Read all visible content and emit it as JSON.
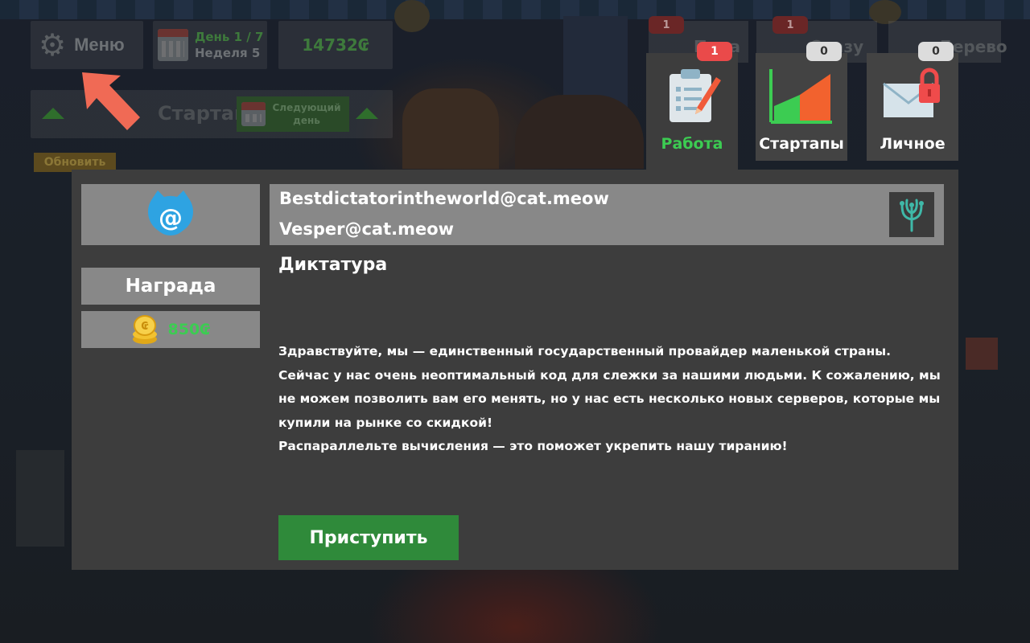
{
  "hud": {
    "menu_label": "Меню",
    "day_label": "День 1 / 7",
    "week_label": "Неделя 5",
    "money": "14732₢",
    "startups_title": "Стартапы",
    "next_day_label": "Следующий день",
    "update_label": "Обновить",
    "dim_tabs": [
      {
        "label": "Пара",
        "badge": "1"
      },
      {
        "label": "Сразу",
        "badge": "1"
      },
      {
        "label": "Дерево",
        "badge": ""
      }
    ]
  },
  "tabs": [
    {
      "label": "Работа",
      "badge": "1",
      "badge_color": "#ea4a4a",
      "active": true,
      "icon": "clipboard-pencil-icon"
    },
    {
      "label": "Стартапы",
      "badge": "0",
      "badge_color": "#dcdcdc",
      "active": false,
      "icon": "growth-chart-icon"
    },
    {
      "label": "Личное",
      "badge": "0",
      "badge_color": "#dcdcdc",
      "active": false,
      "icon": "locked-envelope-icon"
    }
  ],
  "mail": {
    "from": "Bestdictatorintheworld@cat.meow",
    "to": "Vesper@cat.meow",
    "title": "Диктатура",
    "body": [
      "Здравствуйте, мы — единственный государственный провайдер маленькой страны.",
      "Сейчас у нас очень неоптимальный код для слежки за нашими людьми. К сожалению, мы не можем позволить вам его менять, но у нас есть несколько новых серверов, которые мы купили на рынке со скидкой!",
      "Распараллельте вычисления — это поможет укрепить нашу тиранию!"
    ],
    "reward_label": "Награда",
    "reward_value": "850₢",
    "start_label": "Приступить"
  },
  "colors": {
    "accent_green": "#3ccc52",
    "button_green": "#2f8a3a",
    "badge_red": "#ea4a4a",
    "arrow": "#f06a55",
    "panel": "#3d3d3d",
    "panel_light": "#888888"
  }
}
